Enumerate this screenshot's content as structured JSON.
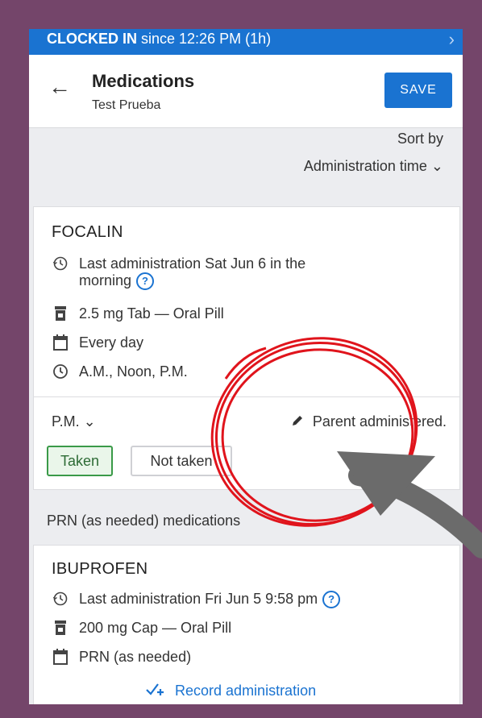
{
  "clock_bar": {
    "status": "CLOCKED IN",
    "since": "since 12:26 PM (1h)",
    "chevron": "›"
  },
  "header": {
    "back_icon": "←",
    "title": "Medications",
    "subtitle": "Test Prueba",
    "save_label": "SAVE"
  },
  "sort": {
    "label": "Sort by",
    "value": "Administration time ⌄"
  },
  "medications": [
    {
      "name": "FOCALIN",
      "last_admin_line1": "Last administration Sat Jun 6 in the",
      "last_admin_line2": "morning",
      "dose": "2.5 mg Tab — Oral Pill",
      "frequency": "Every day",
      "times": "A.M., Noon, P.M.",
      "selected_time": "P.M. ⌄",
      "note": "Parent administered.",
      "taken_label": "Taken",
      "not_taken_label": "Not taken"
    }
  ],
  "prn": {
    "section_label": "PRN (as needed) medications",
    "name": "IBUPROFEN",
    "last_admin": "Last administration Fri Jun 5 9:58 pm",
    "dose": "200 mg Cap — Oral Pill",
    "frequency": "PRN (as needed)",
    "record_label": "Record administration"
  },
  "colors": {
    "accent": "#1a73d1",
    "frame": "#74456a",
    "annotation_red": "#e0141c",
    "annotation_arrow": "#6b6b6b",
    "taken_green": "#3a9a48"
  }
}
